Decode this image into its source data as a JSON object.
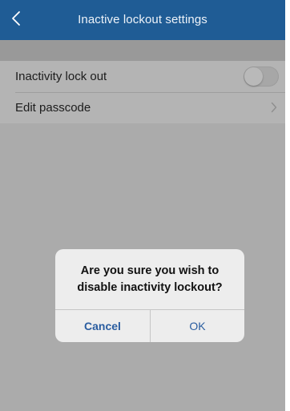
{
  "navbar": {
    "title": "Inactive lockout settings",
    "back_icon": "chevron-left-icon",
    "background_color": "#1f5c95"
  },
  "settings": {
    "rows": [
      {
        "label": "Inactivity lock out",
        "control": "toggle",
        "toggle_on": false
      },
      {
        "label": "Edit passcode",
        "control": "chevron-right-icon"
      }
    ]
  },
  "dialog": {
    "message": "Are you sure you wish to\ndisable inactivity lockout?",
    "cancel_label": "Cancel",
    "ok_label": "OK",
    "button_color": "#2a5da0"
  }
}
